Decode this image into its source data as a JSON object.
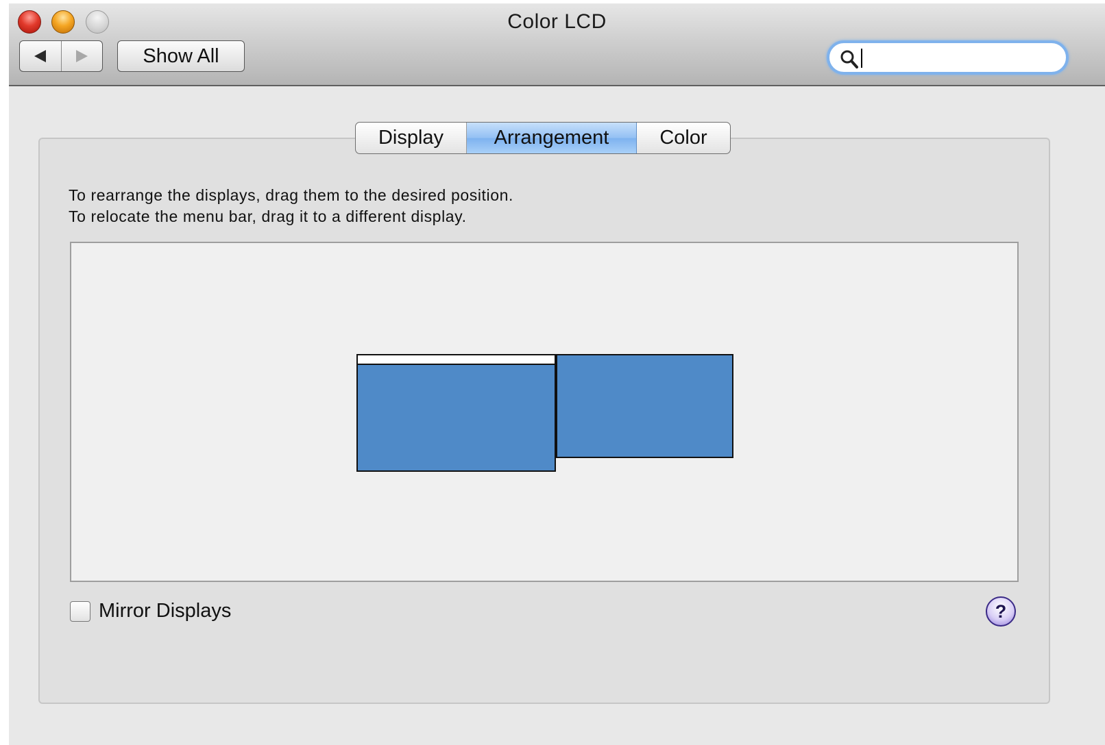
{
  "window": {
    "title": "Color LCD"
  },
  "toolbar": {
    "back_icon": "triangle-left",
    "forward_icon": "triangle-right",
    "show_all_label": "Show All",
    "search": {
      "value": "",
      "placeholder": ""
    }
  },
  "tabs": [
    {
      "label": "Display",
      "selected": false
    },
    {
      "label": "Arrangement",
      "selected": true
    },
    {
      "label": "Color",
      "selected": false
    }
  ],
  "arrangement": {
    "instruction_line1": "To rearrange the displays, drag them to the desired position.",
    "instruction_line2": "To relocate the menu bar, drag it to a different display.",
    "display_color": "#4f8ac8",
    "menubar_on": "main display"
  },
  "mirror": {
    "label": "Mirror Displays",
    "checked": false
  },
  "help": {
    "glyph": "?"
  }
}
